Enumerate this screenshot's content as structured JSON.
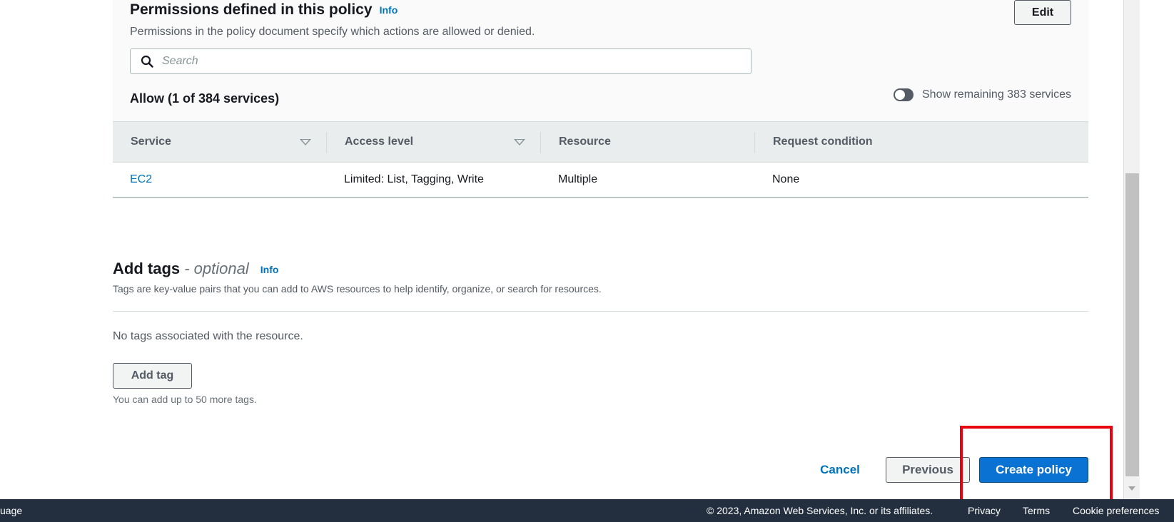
{
  "permissions": {
    "title": "Permissions defined in this policy",
    "info_label": "Info",
    "description": "Permissions in the policy document specify which actions are allowed or denied.",
    "edit_label": "Edit",
    "search_placeholder": "Search",
    "allow_heading": "Allow (1 of 384 services)",
    "toggle_label": "Show remaining 383 services",
    "table": {
      "headers": [
        "Service",
        "Access level",
        "Resource",
        "Request condition"
      ],
      "rows": [
        {
          "service": "EC2",
          "access_level": "Limited: List, Tagging, Write",
          "resource": "Multiple",
          "request_condition": "None"
        }
      ]
    }
  },
  "tags": {
    "title": "Add tags",
    "optional": " - optional",
    "info_label": "Info",
    "description": "Tags are key-value pairs that you can add to AWS resources to help identify, organize, or search for resources.",
    "empty_text": "No tags associated with the resource.",
    "add_tag_label": "Add tag",
    "note": "You can add up to 50 more tags."
  },
  "actions": {
    "cancel_label": "Cancel",
    "previous_label": "Previous",
    "create_label": "Create policy"
  },
  "footer": {
    "left_text": "uage",
    "copyright": "© 2023, Amazon Web Services, Inc. or its affiliates.",
    "privacy": "Privacy",
    "terms": "Terms",
    "cookie": "Cookie preferences"
  },
  "colors": {
    "primary_button": "#0972d3",
    "link": "#0073bb",
    "highlight": "#e8000e",
    "footer_bg": "#232f3e"
  }
}
